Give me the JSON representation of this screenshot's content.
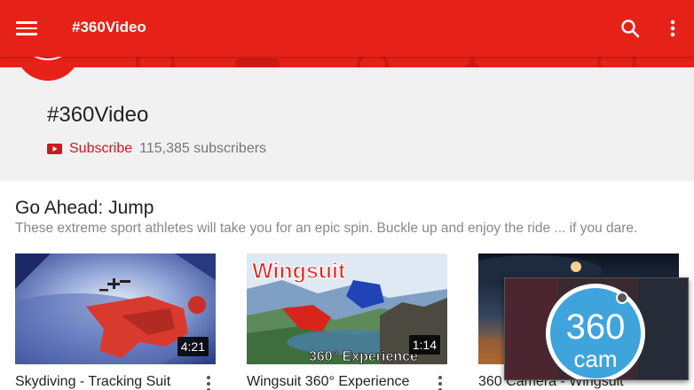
{
  "appbar": {
    "title": "#360Video",
    "menu_icon": "menu-icon",
    "search_icon": "search-icon",
    "more_icon": "more-vert-icon",
    "color": "#e62117"
  },
  "channel": {
    "name": "#360Video",
    "subscribe_label": "Subscribe",
    "subscriber_count": "115,385 subscribers",
    "accent": "#cc181e"
  },
  "section": {
    "title": "Go Ahead: Jump",
    "description": "These extreme sport athletes will take you for an epic spin. Buckle up and enjoy the ride ... if you dare."
  },
  "videos": [
    {
      "title": "Skydiving - Tracking Suit",
      "duration": "4:21"
    },
    {
      "title": "Wingsuit 360° Experience",
      "duration": "1:14",
      "thumb_title": "Wingsuit",
      "thumb_caption": "360° Experience"
    },
    {
      "title": "360 Camera - Wingsuit",
      "duration": ""
    }
  ],
  "overlay": {
    "logo_top": "360",
    "logo_bottom": "cam"
  }
}
